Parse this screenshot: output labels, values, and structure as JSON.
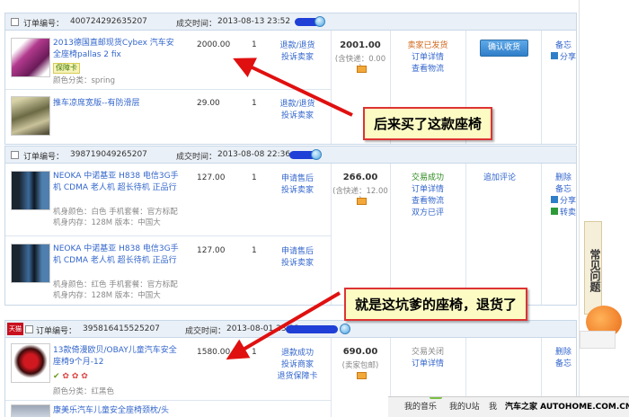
{
  "orders": [
    {
      "order_label": "订单编号：",
      "order_no": "400724292635207",
      "time_label": "成交时间：",
      "time": "2013-08-13 23:52",
      "products": [
        {
          "name": "2013德国直邮现货Cybex 汽车安全座椅pallas 2 fix",
          "badge": "保障卡",
          "attr": "颜色分类：spring",
          "price": "2000.00",
          "qty": "1",
          "service": [
            "退款/退货",
            "投诉卖家"
          ]
        },
        {
          "name": "推车凉席宽版--有防滑层",
          "price": "29.00",
          "qty": "1",
          "service": [
            "退款/退货",
            "投诉卖家"
          ]
        }
      ],
      "total": "2001.00",
      "shipping": "(含快递：0.00 )",
      "status": [
        "卖家已发货",
        "订单详情",
        "查看物流"
      ],
      "confirm_button": "确认收货",
      "side": [
        "备忘",
        "分享"
      ]
    },
    {
      "order_label": "订单编号：",
      "order_no": "398719049265207",
      "time_label": "成交时间：",
      "time": "2013-08-08 22:36",
      "products": [
        {
          "name": "NEOKA 中诺基亚 H838 电信3G手机 CDMA 老人机 超长待机 正品行",
          "attr": "机身颜色：白色 手机套餐：官方标配 机身内存：128M 版本：中国大",
          "price": "127.00",
          "qty": "1",
          "service": [
            "申请售后",
            "投诉卖家"
          ]
        },
        {
          "name": "NEOKA 中诺基亚 H838 电信3G手机 CDMA 老人机 超长待机 正品行",
          "attr": "机身颜色：红色 手机套餐：官方标配 机身内存：128M 版本：中国大",
          "price": "127.00",
          "qty": "1",
          "service": [
            "申请售后",
            "投诉卖家"
          ]
        }
      ],
      "total": "266.00",
      "shipping": "(含快递：12.00 )",
      "status": [
        "交易成功",
        "订单详情",
        "查看物流",
        "双方已评"
      ],
      "review": "追加评论",
      "side": [
        "删除",
        "备忘",
        "分享",
        "转卖"
      ]
    },
    {
      "store_tag": "天猫",
      "order_label": "订单编号：",
      "order_no": "395816415525207",
      "time_label": "成交时间：",
      "time": "2013-08-01 23:33",
      "products": [
        {
          "name": "13款倚漫欧贝/OBAY儿童汽车安全座椅9个月-12",
          "attr": "颜色分类：红黑色",
          "price": "1580.00",
          "qty": "1",
          "service": [
            "退款成功",
            "投诉商家",
            "退货保障卡"
          ]
        },
        {
          "name": "康美乐汽车儿童安全座椅颈枕/头"
        }
      ],
      "total": "690.00",
      "shipping": "(卖家包邮)",
      "status": [
        "交易关闭",
        "订单详情"
      ],
      "side": [
        "删除",
        "备忘"
      ]
    }
  ],
  "callouts": {
    "top": "后来买了这款座椅",
    "bottom": "就是这坑爹的座椅，退货了"
  },
  "faq": "常见问题",
  "bottom_bar": [
    "我的音乐",
    "我的U站",
    "我",
    "汽车之家 AUTOHOME.COM.CN"
  ],
  "colors": {
    "accent": "#3366cc",
    "arrow": "#e01010",
    "scribble": "#1f3fd6",
    "header_bg": "#eaf0f7"
  }
}
